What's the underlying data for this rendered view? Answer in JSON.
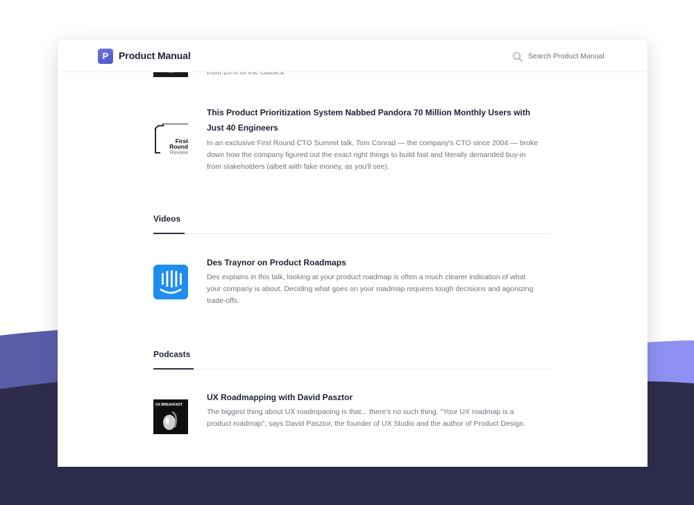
{
  "app": {
    "logo_letter": "P",
    "title": "Product Manual",
    "search_placeholder": "Search Product Manual"
  },
  "articles": {
    "cut_off_desc": "from 20% of the causes.",
    "first_round": {
      "title": "This Product Prioritization System Nabbed Pandora 70 Million Monthly Users with Just 40 Engineers",
      "description": "In an exclusive First Round CTO Summit talk, Tom Conrad — the company's CTO since 2004 — broke down how the company figured out the exact right things to build fast and literally demanded buy-in from stakeholders (albeit with fake money, as you'll see).",
      "thumb_line1": "First",
      "thumb_line2": "Round",
      "thumb_line3": "Review"
    }
  },
  "videos": {
    "heading": "Videos",
    "items": [
      {
        "title": "Des Traynor on Product Roadmaps",
        "description": "Des explains in this talk, looking at your product roadmap is often a much clearer indication of what your company is about. Deciding what goes on your roadmap requires tough decisions and agonizing trade-offs."
      }
    ]
  },
  "podcasts": {
    "heading": "Podcasts",
    "items": [
      {
        "title": "UX Roadmapping with David Pasztor",
        "description": "The biggest thing about UX roadmpaoing is that... there's no such thing. \"Your UX roadmap is a product roadmap\", says David Pasztor, the founder of UX Studio and the author of Product Design.",
        "thumb_label": "UX BREAKFAST"
      }
    ]
  },
  "colors": {
    "brand": "#5b64d8",
    "background_dark": "#2d2c4b",
    "wave_light": "#8e91f1",
    "intercom_blue": "#1f8ded"
  }
}
